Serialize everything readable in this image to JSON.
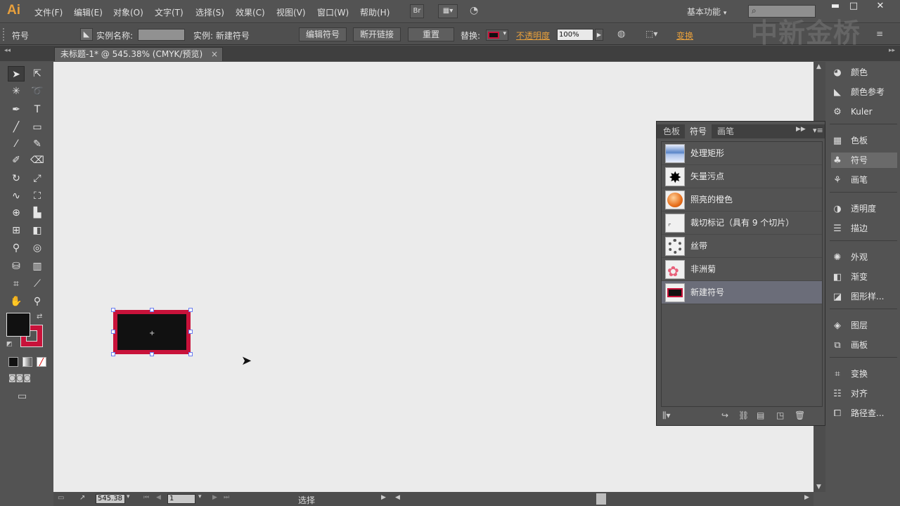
{
  "app": {
    "logo": "Ai"
  },
  "menubar": {
    "items": [
      "文件(F)",
      "编辑(E)",
      "对象(O)",
      "文字(T)",
      "选择(S)",
      "效果(C)",
      "视图(V)",
      "窗口(W)",
      "帮助(H)"
    ],
    "bridge_label": "Br",
    "workspace": "基本功能",
    "search_placeholder": ""
  },
  "control_bar": {
    "mode_label": "符号",
    "instance_name_label": "实例名称:",
    "instance_label": "实例: 新建符号",
    "edit_symbol_btn": "编辑符号",
    "break_link_btn": "断开链接",
    "reset_btn": "重置",
    "replace_label": "替换:",
    "opacity_label": "不透明度",
    "opacity_value": "100%",
    "transform_label": "变换"
  },
  "watermark": "中新金桥",
  "document_tab": {
    "title": "未标题-1* @ 545.38% (CMYK/预览)",
    "close": "×"
  },
  "status_bar": {
    "zoom": "545.38",
    "page": "1",
    "status_text": "选择"
  },
  "colors": {
    "fill": "#111111",
    "stroke": "#c8123a",
    "selection_handle": "#6a7cf0"
  },
  "dock": {
    "groups": [
      [
        "颜色",
        "颜色参考",
        "Kuler"
      ],
      [
        "色板",
        "符号",
        "画笔"
      ],
      [
        "透明度",
        "描边"
      ],
      [
        "外观",
        "渐变",
        "图形样..."
      ],
      [
        "图层",
        "画板"
      ],
      [
        "变换",
        "对齐",
        "路径查..."
      ]
    ],
    "icons": [
      [
        "palette-icon",
        "color-guide-icon",
        "kuler-icon"
      ],
      [
        "swatches-icon",
        "symbols-icon",
        "brushes-icon"
      ],
      [
        "transparency-icon",
        "stroke-icon"
      ],
      [
        "appearance-icon",
        "gradient-icon",
        "graphic-styles-icon"
      ],
      [
        "layers-icon",
        "artboards-icon"
      ],
      [
        "transform-icon",
        "align-icon",
        "pathfinder-icon"
      ]
    ],
    "active": "符号"
  },
  "symbols_panel": {
    "tabs": [
      "色板",
      "符号",
      "画笔"
    ],
    "active_tab": "符号",
    "items": [
      "处理矩形",
      "矢量污点",
      "照亮的橙色",
      "裁切标记（具有 9 个切片）",
      "丝带",
      "非洲菊",
      "新建符号"
    ],
    "selected": "新建符号"
  }
}
